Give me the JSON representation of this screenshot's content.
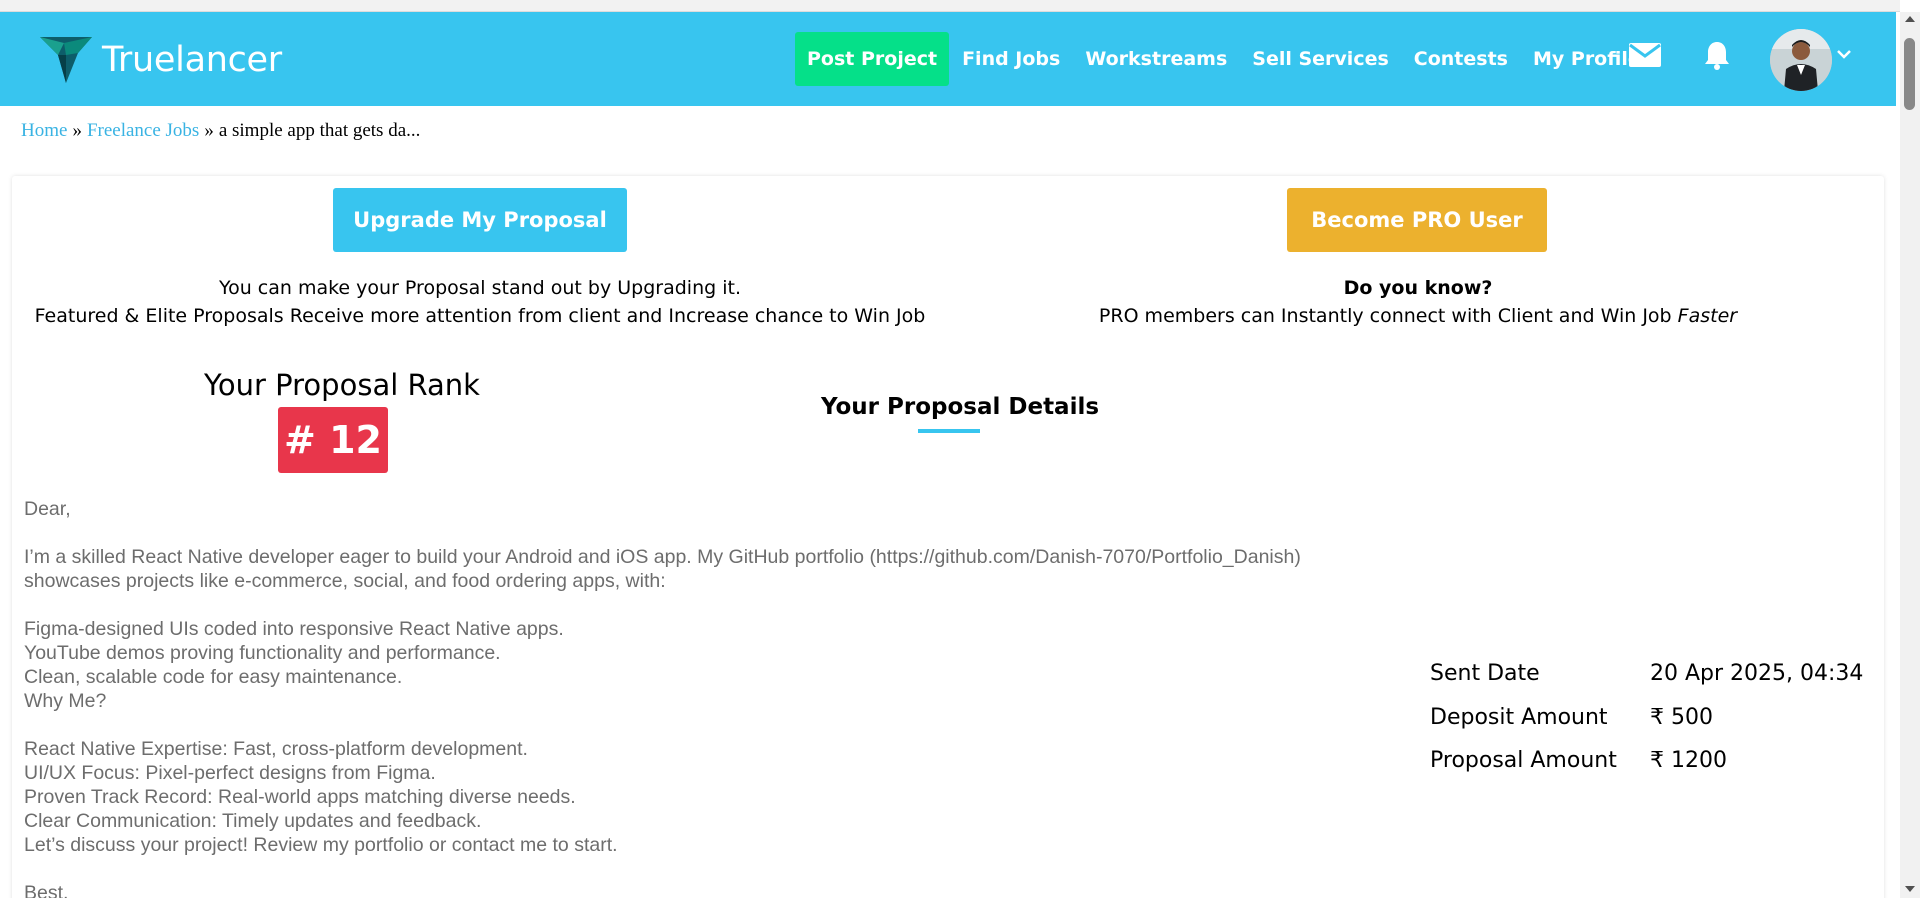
{
  "brand": {
    "name": "Truelancer"
  },
  "nav": {
    "post_project": "Post Project",
    "find_jobs": "Find Jobs",
    "workstreams": "Workstreams",
    "sell_services": "Sell Services",
    "contests": "Contests",
    "my_profile": "My Profile"
  },
  "breadcrumb": {
    "home": "Home",
    "sep": "»",
    "freelance_jobs": "Freelance Jobs",
    "current": "a simple app that gets da..."
  },
  "upgrade": {
    "button": "Upgrade My Proposal",
    "line1": "You can make your Proposal stand out by Upgrading it.",
    "line2": "Featured & Elite Proposals Receive more attention from client and Increase chance to Win Job"
  },
  "pro": {
    "button": "Become PRO User",
    "heading": "Do you know?",
    "line_main": "PRO members can Instantly connect with Client and Win Job ",
    "line_em": "Faster"
  },
  "rank": {
    "title": "Your Proposal Rank",
    "value": "# 12"
  },
  "details": {
    "title": "Your Proposal Details",
    "lines": [
      "Dear,",
      "",
      "I’m a skilled React Native developer eager to build your Android and iOS app. My GitHub portfolio (https://github.com/Danish-7070/Portfolio_Danish)",
      "showcases projects like e-commerce, social, and food ordering apps, with:",
      "",
      "Figma-designed UIs coded into responsive React Native apps.",
      "YouTube demos proving functionality and performance.",
      "Clean, scalable code for easy maintenance.",
      "Why Me?",
      "",
      "React Native Expertise: Fast, cross-platform development.",
      "UI/UX Focus: Pixel-perfect designs from Figma.",
      "Proven Track Record: Real-world apps matching diverse needs.",
      "Clear Communication: Timely updates and feedback.",
      "Let’s discuss your project! Review my portfolio or contact me to start.",
      "",
      "Best,"
    ]
  },
  "info": {
    "sent_date_label": "Sent Date",
    "sent_date_value": "20 Apr 2025, 04:34",
    "deposit_label": "Deposit Amount",
    "deposit_value": "₹ 500",
    "proposal_label": "Proposal Amount",
    "proposal_value": "₹ 1200"
  },
  "colors": {
    "navbar": "#38c5ef",
    "post_project": "#05e089",
    "pro_button": "#ecb12e",
    "rank_badge": "#e8364b"
  },
  "icons": [
    "brand-logo-icon",
    "mail-icon",
    "bell-icon",
    "chevron-down-icon"
  ]
}
